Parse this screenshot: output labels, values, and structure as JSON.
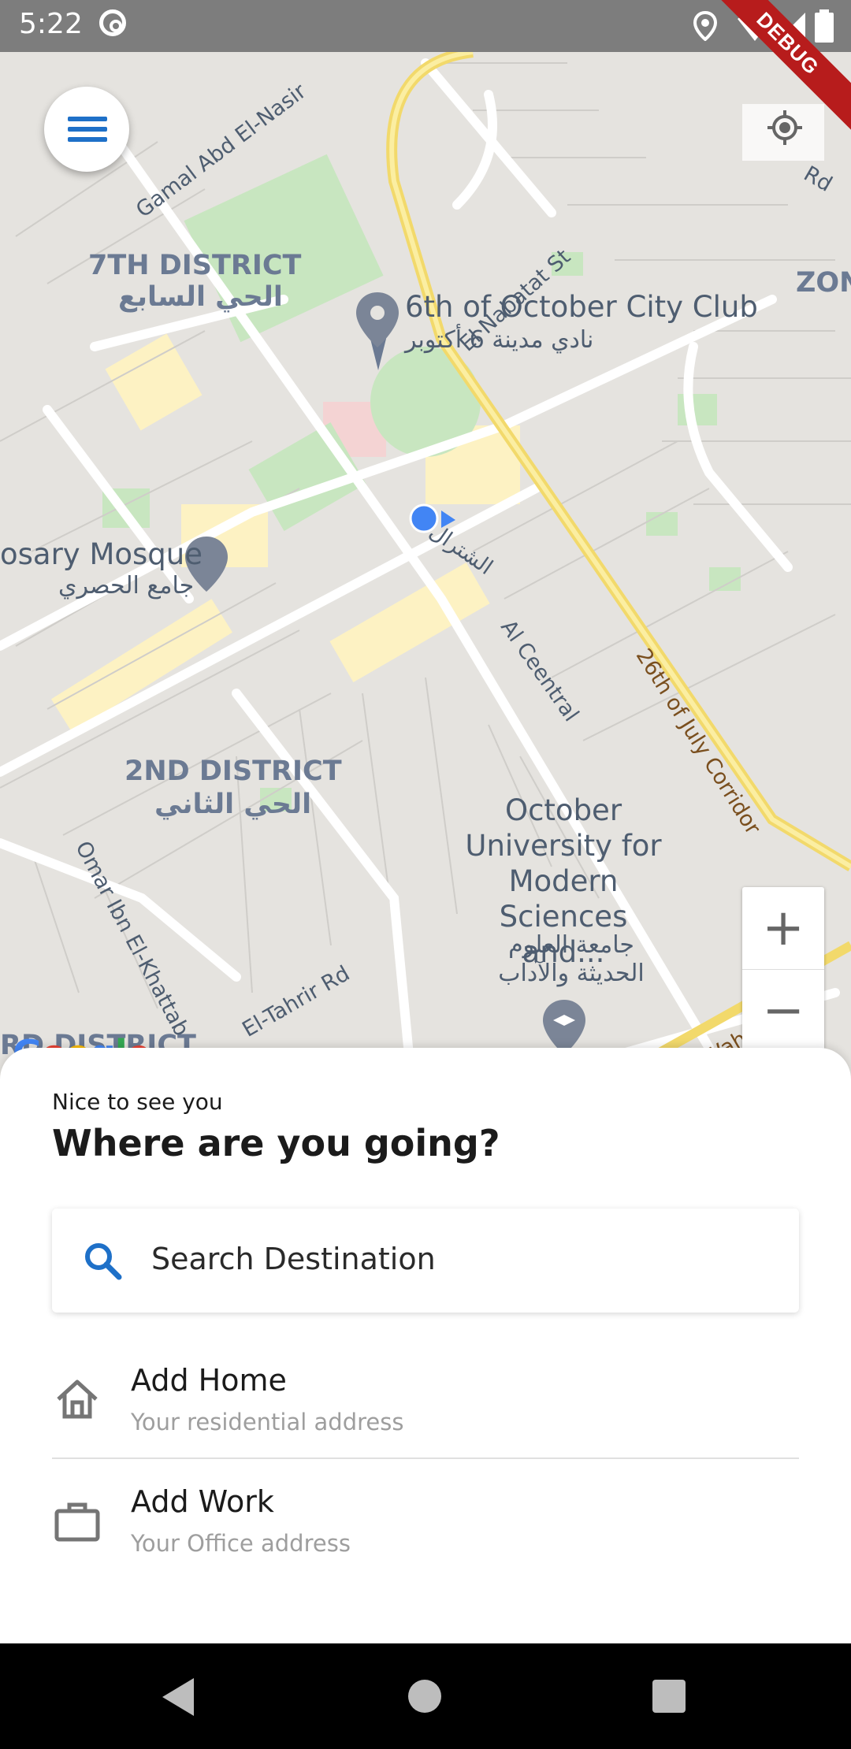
{
  "status_bar": {
    "time": "5:22",
    "debug_label": "DEBUG"
  },
  "map": {
    "districts": {
      "seventh_en": "7TH DISTRICT",
      "seventh_ar": "الحي السابع",
      "second_en": "2ND DISTRICT",
      "second_ar": "الحي الثاني",
      "third_partial": "RD DISTRICT",
      "zone_partial": "ZON"
    },
    "pois": {
      "club_en": "6th of October City Club",
      "club_ar": "نادي مدينة 6 أكتوبر",
      "mosque_en": "osary Mosque",
      "mosque_ar": "جامع الحصري",
      "university_en": "October University for Modern Sciences and...",
      "university_ar": "جامعة العلوم الحديثة والآداب",
      "local_ar": "الشترال"
    },
    "roads": {
      "gamal": "Gamal Abd El-Nasir",
      "nabatat": "El Nabatat St",
      "central": "Al Ceentral",
      "july": "26th of July Corridor",
      "omar": "Omar Ibn El-Khattab",
      "tahrir": "El-Tahrir Rd",
      "wahat": "El Wahat Rd",
      "corner": "Rd"
    },
    "google_logo": [
      "G",
      "o",
      "o",
      "g",
      "l",
      "e"
    ],
    "zoom_in": "+",
    "zoom_out": "−"
  },
  "sheet": {
    "greeting": "Nice to see you",
    "title": "Where are you going?",
    "search_label": "Search Destination",
    "favorites": [
      {
        "title": "Add Home",
        "subtitle": "Your residential address",
        "icon": "home-icon"
      },
      {
        "title": "Add Work",
        "subtitle": "Your Office address",
        "icon": "briefcase-icon"
      }
    ]
  },
  "colors": {
    "accent": "#1e70c8",
    "user_location": "#4285f4",
    "debug": "#b71c1c"
  }
}
